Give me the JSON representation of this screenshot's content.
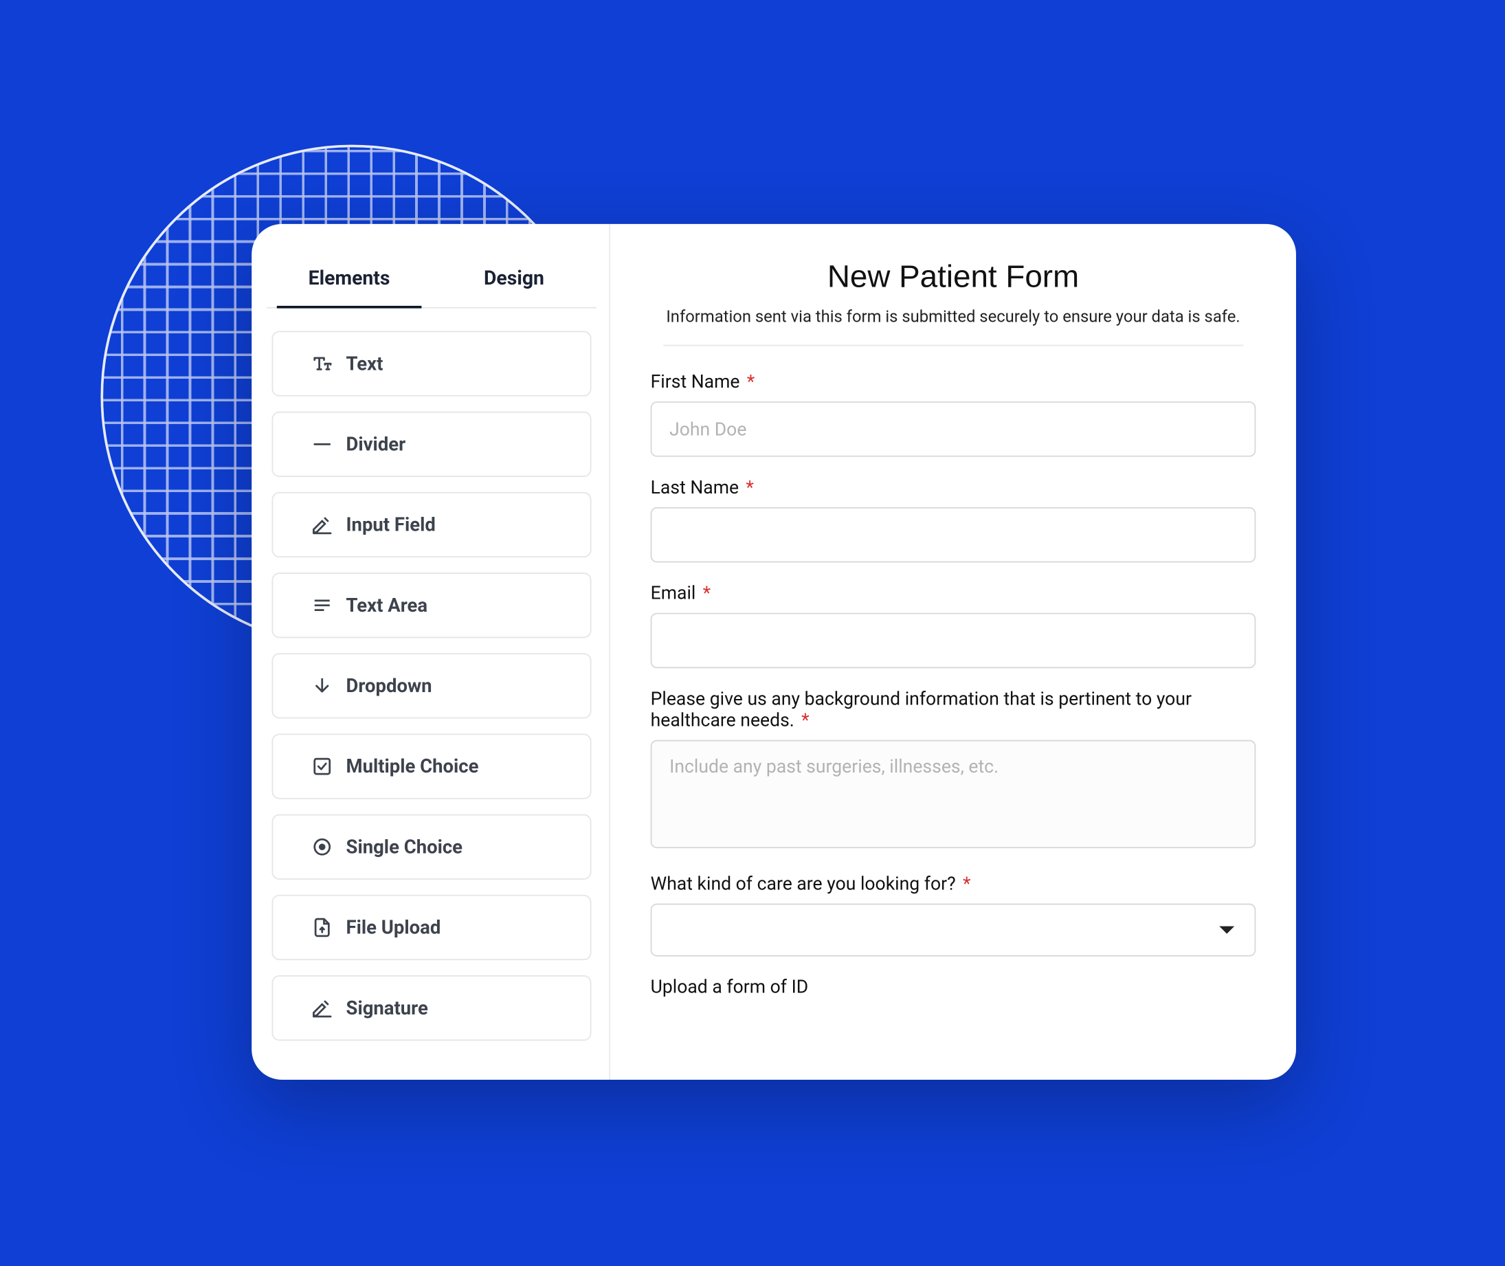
{
  "sidebar": {
    "tabs": {
      "elements": "Elements",
      "design": "Design",
      "active": "elements"
    },
    "items": [
      {
        "id": "text",
        "label": "Text",
        "icon": "text-icon"
      },
      {
        "id": "divider",
        "label": "Divider",
        "icon": "divider-icon"
      },
      {
        "id": "input",
        "label": "Input Field",
        "icon": "input-field-icon"
      },
      {
        "id": "textarea",
        "label": "Text Area",
        "icon": "text-area-icon"
      },
      {
        "id": "dropdown",
        "label": "Dropdown",
        "icon": "dropdown-icon"
      },
      {
        "id": "multiple",
        "label": "Multiple Choice",
        "icon": "multiple-choice-icon"
      },
      {
        "id": "single",
        "label": "Single Choice",
        "icon": "single-choice-icon"
      },
      {
        "id": "file",
        "label": "File Upload",
        "icon": "file-upload-icon"
      },
      {
        "id": "signature",
        "label": "Signature",
        "icon": "signature-icon"
      }
    ]
  },
  "form": {
    "title": "New Patient Form",
    "subtitle": "Information sent via this form is submitted securely to ensure your data is safe.",
    "fields": {
      "first_name": {
        "label": "First Name",
        "required": true,
        "placeholder": "John Doe",
        "value": ""
      },
      "last_name": {
        "label": "Last Name",
        "required": true,
        "value": ""
      },
      "email": {
        "label": "Email",
        "required": true,
        "value": ""
      },
      "background": {
        "label": "Please give us any background information that is pertinent to your healthcare needs.",
        "required": true,
        "placeholder": "Include any past surgeries, illnesses, etc.",
        "value": ""
      },
      "care_kind": {
        "label": "What kind of care are you looking for?",
        "required": true,
        "value": ""
      },
      "upload_id": {
        "label": "Upload a form of ID",
        "required": false
      }
    }
  },
  "required_marker": "*"
}
